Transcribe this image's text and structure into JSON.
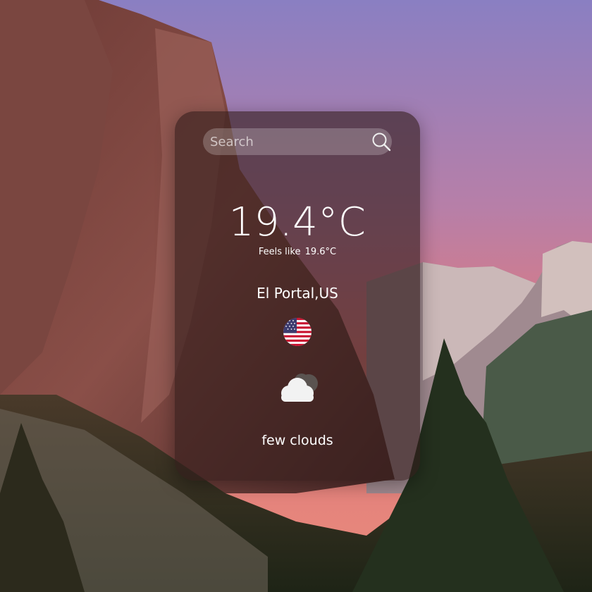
{
  "search": {
    "placeholder": "Search",
    "button_icon": "magnifier-icon"
  },
  "weather": {
    "temperature": "19.4°C",
    "feels_like_label": "Feels like",
    "feels_like_value": "19.6°C",
    "location": "El Portal,US",
    "country_flag": "us-flag-icon",
    "condition_icon": "few-clouds-icon",
    "description": "few clouds"
  },
  "colors": {
    "card_background": "#301c1a",
    "text": "#ffffff",
    "sky_top": "#8a7fc2",
    "sky_bottom": "#e07a7d"
  }
}
